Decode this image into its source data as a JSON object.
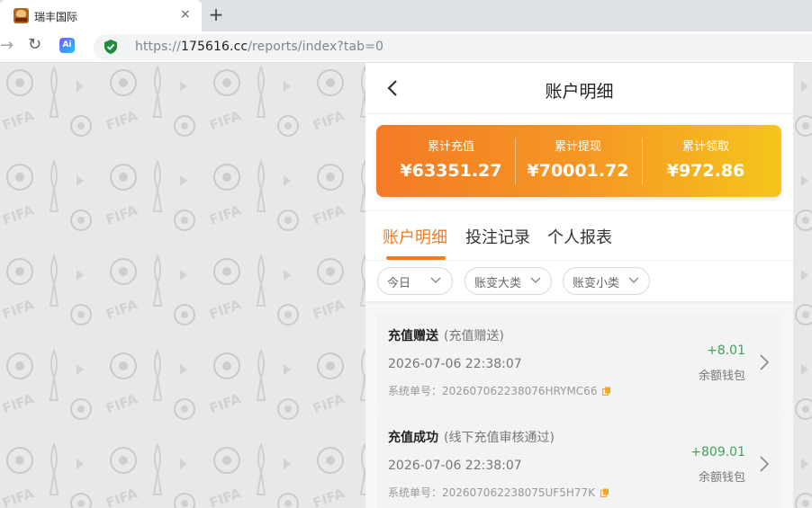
{
  "browser": {
    "tab_title": "瑞丰国际",
    "tab_close": "×",
    "new_tab": "+",
    "url_scheme": "https://",
    "url_host": "175616.cc",
    "url_path": "/reports/index?tab=0",
    "ai_label": "Ai"
  },
  "page": {
    "title": "账户明细"
  },
  "summary": [
    {
      "label": "累计充值",
      "value": "¥63351.27"
    },
    {
      "label": "累计提现",
      "value": "¥70001.72"
    },
    {
      "label": "累计领取",
      "value": "¥972.86"
    }
  ],
  "tabs": [
    {
      "label": "账户明细",
      "active": true
    },
    {
      "label": "投注记录",
      "active": false
    },
    {
      "label": "个人报表",
      "active": false
    }
  ],
  "filters": [
    {
      "label": "今日"
    },
    {
      "label": "账变大类"
    },
    {
      "label": "账变小类"
    }
  ],
  "records": [
    {
      "title": "充值赠送",
      "subtitle": "(充值赠送)",
      "time": "2026-07-06 22:38:07",
      "order": "系统单号：202607062238076HRYMC66",
      "amount": "+8.01",
      "wallet": "余额钱包"
    },
    {
      "title": "充值成功",
      "subtitle": "(线下充值审核通过)",
      "time": "2026-07-06 22:38:07",
      "order": "系统单号：202607062238075UF5H77K",
      "amount": "+809.01",
      "wallet": "余额钱包"
    }
  ],
  "colors": {
    "accent": "#f47a20",
    "gradient_start": "#f47a25",
    "gradient_end": "#f5c51c",
    "positive": "#3aa55a"
  }
}
